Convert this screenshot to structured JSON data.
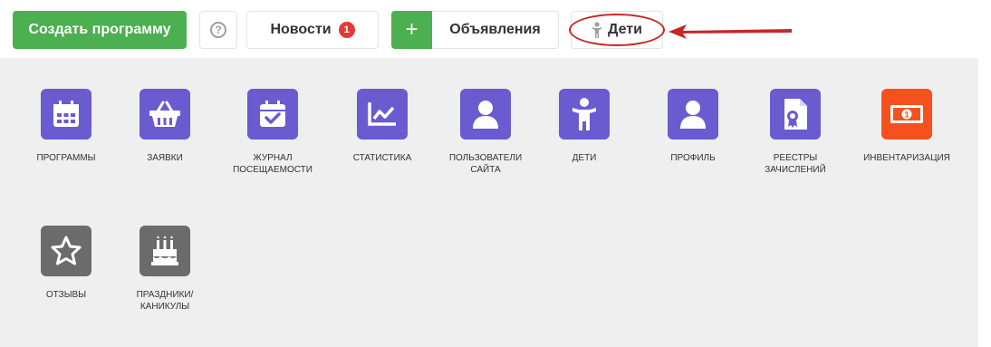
{
  "toolbar": {
    "create_label": "Создать программу",
    "help_label": "?",
    "news_label": "Новости",
    "news_badge": "1",
    "plus_label": "+",
    "ads_label": "Объявления",
    "kids_label": "Дети"
  },
  "colors": {
    "green": "#4caf50",
    "purple": "#6a5bd1",
    "orange": "#f4511e",
    "gray": "#6b6b6b",
    "annotation_red": "#c62828"
  },
  "tiles": [
    {
      "label": "ПРОГРАММЫ",
      "icon": "calendar-grid-icon"
    },
    {
      "label": "ЗАЯВКИ",
      "icon": "basket-icon"
    },
    {
      "label": "ЖУРНАЛ ПОСЕЩАЕМОСТИ",
      "icon": "calendar-check-icon"
    },
    {
      "label": "СТАТИСТИКА",
      "icon": "line-chart-icon"
    },
    {
      "label": "ПОЛЬЗОВАТЕЛИ САЙТА",
      "icon": "user-icon"
    },
    {
      "label": "ДЕТИ",
      "icon": "child-icon"
    },
    {
      "label": "ПРОФИЛЬ",
      "icon": "profile-icon"
    },
    {
      "label": "РЕЕСТРЫ ЗАЧИСЛЕНИЙ",
      "icon": "certificate-document-icon"
    },
    {
      "label": "ИНВЕНТАРИЗАЦИЯ",
      "icon": "money-icon"
    },
    {
      "label": "ОТЗЫВЫ",
      "icon": "star-icon"
    },
    {
      "label": "ПРАЗДНИКИ/ КАНИКУЛЫ",
      "icon": "birthday-cake-icon"
    }
  ]
}
